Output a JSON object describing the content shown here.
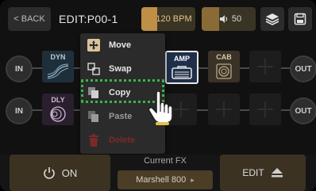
{
  "topbar": {
    "back_label": "< BACK",
    "title": "EDIT:P00-1",
    "bpm": "120 BPM",
    "volume": "50",
    "layers_icon": "layers-icon",
    "save_icon": "save-icon"
  },
  "chains": {
    "in_label": "IN",
    "out_label": "OUT",
    "fx_dyn": "DYN",
    "fx_dly": "DLY",
    "fx_amp": "AMP",
    "fx_cab": "CAB"
  },
  "menu": {
    "items": [
      {
        "label": "Move",
        "icon": "move-icon"
      },
      {
        "label": "Swap",
        "icon": "swap-icon"
      },
      {
        "label": "Copy",
        "icon": "copy-icon"
      },
      {
        "label": "Paste",
        "icon": "paste-icon"
      },
      {
        "label": "Delete",
        "icon": "trash-icon"
      }
    ]
  },
  "bottom": {
    "on_label": "ON",
    "current_fx_label": "Current FX",
    "current_fx_value": "Marshell 800",
    "edit_label": "EDIT"
  },
  "colors": {
    "accent": "#bf8f46",
    "highlight": "#39b54a",
    "delete": "#7a2a2a"
  }
}
